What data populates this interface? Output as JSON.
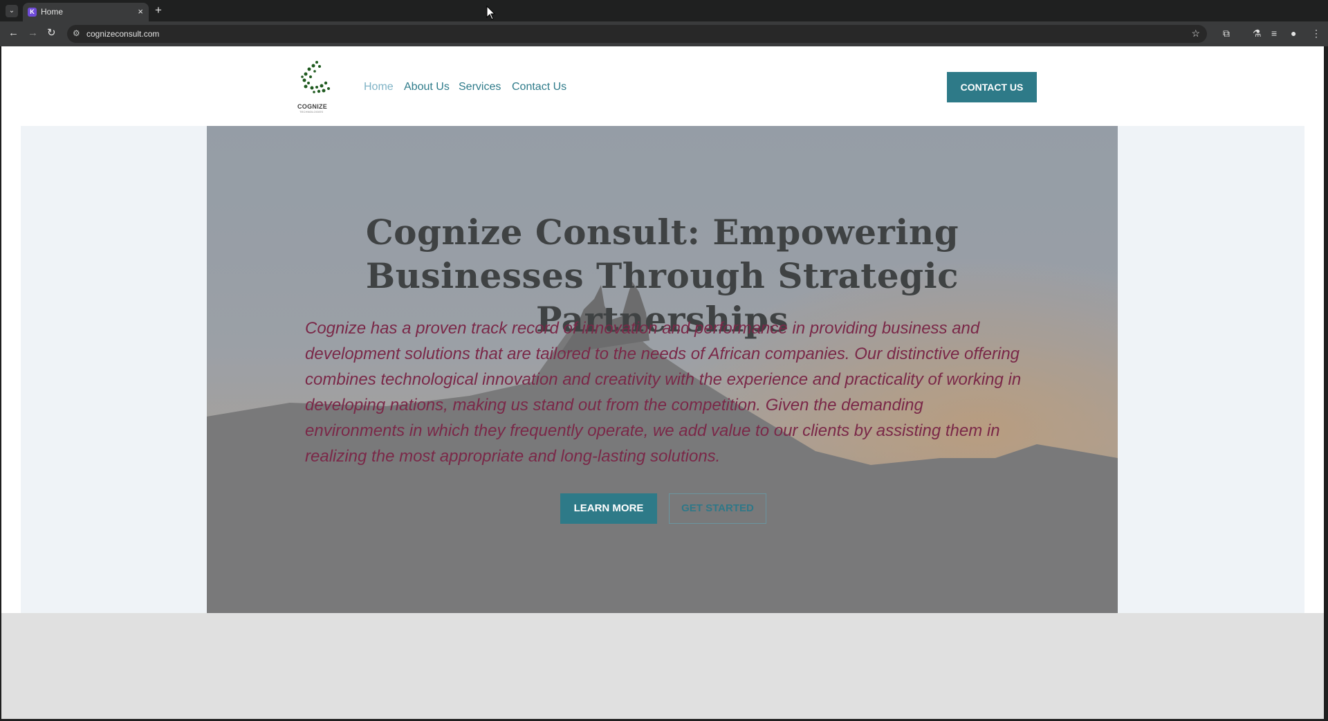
{
  "browser": {
    "tab_title": "Home",
    "tab_close": "×",
    "new_tab": "+",
    "url": "cognizeconsult.com",
    "icons": [
      "tab-list-icon",
      "favicon-icon",
      "close-icon",
      "new-tab-icon",
      "back-icon",
      "forward-icon",
      "reload-icon",
      "site-info-icon",
      "bookmark-star-icon",
      "extensions-icon",
      "labs-icon",
      "media-icon",
      "profile-icon",
      "menu-icon"
    ]
  },
  "site": {
    "logo_text": "COGNIZE",
    "logo_subtext": "TECHNOLOGIES",
    "nav": [
      "Home",
      "About Us",
      "Services",
      "Contact Us"
    ],
    "contact_button": "CONTACT US"
  },
  "hero": {
    "title": "Cognize Consult: Empowering Businesses Through Strategic Partnerships",
    "description": "Cognize has a proven track record of innovation and performance in providing business and development solutions that are tailored to the needs of African companies. Our distinctive offering combines technological innovation and creativity with the experience and practicality of working in developing nations, making us stand out from the competition. Given the demanding environments in which they frequently operate, we add value to our clients by assisting them in realizing the most appropriate and long-lasting solutions.",
    "learn_more": "LEARN MORE",
    "get_started": "GET STARTED"
  },
  "colors": {
    "accent": "#2e7a88",
    "nav_active": "#7fb3c6",
    "description": "#7a2848",
    "title": "#3f4243"
  }
}
